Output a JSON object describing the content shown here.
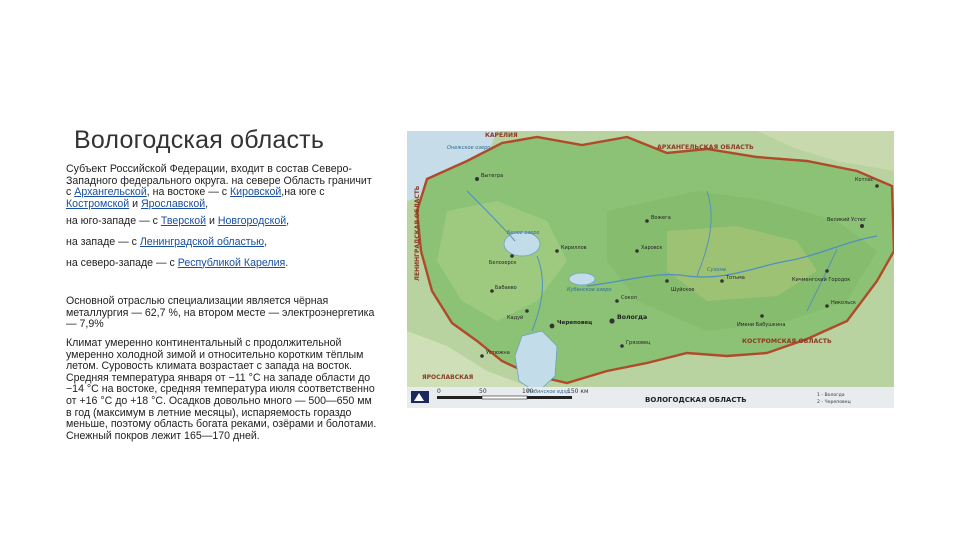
{
  "slide": {
    "title": "Вологодская область",
    "intro": "Субъект Российской Федерации, входит в состав Северо-Западного федерального округа. на севере Область граничит с ",
    "intro_link_arkh": "Архангельской",
    "intro_mid1": ", на востоке — с ",
    "intro_link_kirov": "Кировской",
    "intro_mid2": ",на юге с ",
    "intro_link_kostroma": "Костромской",
    "intro_mid3": " и ",
    "intro_link_yaroslavl": "Ярославской",
    "intro_end": ",",
    "sw_prefix": "на юго-западе — с ",
    "sw_link_tver": "Тверской",
    "sw_mid": " и ",
    "sw_link_novgorod": "Новгородской",
    "sw_end": ",",
    "w_prefix": "на западе — с ",
    "w_link": "Ленинградской областью",
    "w_end": ",",
    "nw_prefix": "на северо-западе — с ",
    "nw_link": "Республикой Карелия",
    "nw_end": ".",
    "industry": "Основной отраслью специализации является чёрная металлургия — 62,7 %, на втором месте — электроэнергетика — 7,9%",
    "climate": "Климат умеренно континентальный с продолжительной умеренно холодной зимой и относительно коротким тёплым летом. Суровость климата возрастает с запада на восток. Средняя температура января от −11 °C на западе области до −14 °C на востоке, средняя температура июля соответственно от +16 °C до +18 °C. Осадков довольно много — 500—650 мм в год (максимум в летние месяцы), испаряемость гораздо меньше, поэтому область богата реками, озёрами и болотами. Снежный покров лежит 165—170 дней."
  },
  "map": {
    "region_name": "ВОЛОГОДСКАЯ ОБЛАСТЬ",
    "neighbor_karelia": "КАРЕЛИЯ",
    "neighbor_arkh": "АРХАНГЕЛЬСКАЯ ОБЛАСТЬ",
    "neighbor_len": "ЛЕНИНГРАДСКАЯ ОБЛАСТЬ",
    "neighbor_kostroma": "КОСТРОМСКАЯ ОБЛАСТЬ",
    "neighbor_yar": "ЯРОСЛАВСКАЯ",
    "lake_onega": "Онежское озеро",
    "lake_white": "Белое озеро",
    "lake_kubenskoe": "Кубенское озеро",
    "lake_rybinsk": "Рыбинское вдхр.",
    "river_sukhona": "Сухона",
    "city_vytegra": "Вытегра",
    "city_vologda": "Вологда",
    "city_cherepovets": "Череповец",
    "city_kirillov": "Кириллов",
    "city_belozersk": "Белозерск",
    "city_totma": "Тотьма",
    "city_velikiy_ustyug": "Великий Устюг",
    "city_sokol": "Сокол",
    "city_babaevo": "Бабаево",
    "city_kadui": "Кадуй",
    "city_ustyuzhna": "Устюжна",
    "city_kharovsk": "Харовск",
    "city_nikolsk": "Никольск",
    "city_kichmengsky": "Кичменгский Городок",
    "city_gryazovets": "Грязовец",
    "city_kotlas": "Котлас",
    "city_vozhega": "Вожега",
    "city_shuyskoe": "Шуйское",
    "city_imenevo": "Имени Бабушкина",
    "scale_0": "0",
    "scale_50": "50",
    "scale_100": "100",
    "scale_150": "150 км",
    "legend_line1": "1 - Вологда",
    "legend_line2": "2 - Череповец"
  }
}
